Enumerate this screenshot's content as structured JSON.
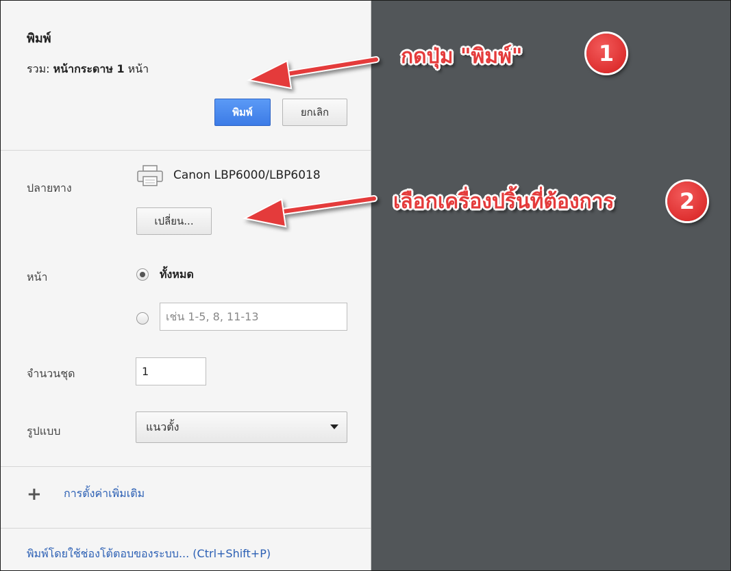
{
  "dialog": {
    "title": "พิมพ์",
    "total_prefix": "รวม: ",
    "total_value": "หน้ากระดาษ 1",
    "total_suffix": " หน้า",
    "print_button": "พิมพ์",
    "cancel_button": "ยกเลิก"
  },
  "destination": {
    "label": "ปลายทาง",
    "printer_icon": "printer-icon",
    "printer_name": "Canon LBP6000/LBP6018",
    "change_button": "เปลี่ยน..."
  },
  "pages": {
    "label": "หน้า",
    "option_all": "ทั้งหมด",
    "option_all_selected": true,
    "custom_placeholder": "เช่น 1-5, 8, 11-13"
  },
  "copies": {
    "label": "จำนวนชุด",
    "value": "1"
  },
  "layout": {
    "label": "รูปแบบ",
    "selected": "แนวตั้ง"
  },
  "more_settings": {
    "icon": "plus-icon",
    "label": "การตั้งค่าเพิ่มเติม"
  },
  "system_dialog": {
    "label": "พิมพ์โดยใช้ช่องโต้ตอบของระบบ... (Ctrl+Shift+P)"
  },
  "annotations": {
    "note_1": "กดปุ่ม \"พิมพ์\"",
    "badge_1": "1",
    "note_2": "เลือกเครื่องปริ้นที่ต้องการ",
    "badge_2": "2",
    "note_color": "#e43b3b",
    "badge_color": "#d61e1e"
  },
  "colors": {
    "panel_bg": "#f5f5f5",
    "preview_bg": "#525659",
    "print_button_bg": "#4a89f0",
    "link": "#2b5fb4"
  }
}
